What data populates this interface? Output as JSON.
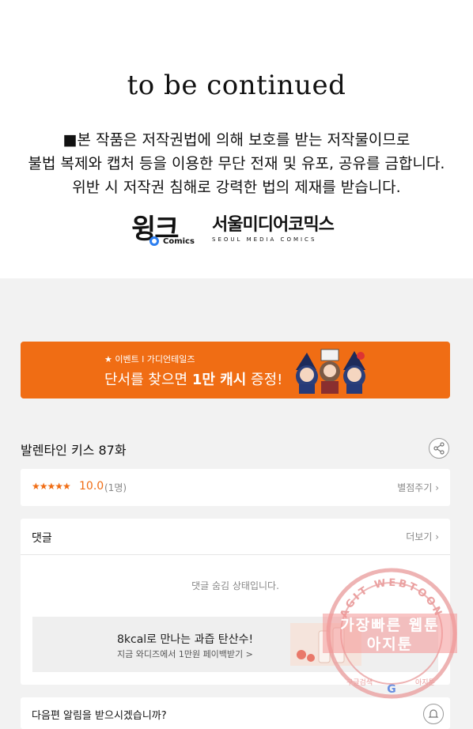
{
  "header": {
    "to_be_continued": "to be continued",
    "notice_lines": [
      "■본 작품은 저작권법에 의해 보호를 받는 저작물이므로",
      "불법 복제와 캡처 등을 이용한 무단 전재 및 유포, 공유를 금합니다.",
      "위반 시 저작권 침해로 강력한 법의 제재를 받습니다."
    ],
    "logo_wink": "윙크",
    "logo_wink_sub": "Comics",
    "logo_smc": "서울미디어코믹스",
    "logo_smc_sub": "SEOUL MEDIA COMICS"
  },
  "banner": {
    "small": "★ 이벤트 l 가디언테일즈",
    "big_pre": "단서를 찾으면 ",
    "big_bold": "1만 캐시",
    "big_post": " 증정!"
  },
  "episode": {
    "title": "발렌타인 키스 87화"
  },
  "rating": {
    "stars": "★★★★★",
    "score": "10.0",
    "count": "(1명)",
    "rate_link": "별점주기 ›"
  },
  "comments": {
    "header": "댓글",
    "more": "더보기 ›",
    "hidden_msg": "댓글 숨김 상태입니다.",
    "ad_title": "8kcal로 만나는 과즙 탄산수!",
    "ad_sub": "지금 와디즈에서 1만원 페이백받기 >"
  },
  "alarm": {
    "text": "다음편 알림을 받으시겠습니까?"
  },
  "watermark": {
    "ring_text": "AGIT WEBTOON",
    "line1": "가장빠른 웹툰",
    "line2": "아지툰",
    "bottom_left": "구글검색",
    "bottom_right": "아지툰"
  },
  "colors": {
    "accent": "#f06d14",
    "watermark": "#e88a8a"
  }
}
